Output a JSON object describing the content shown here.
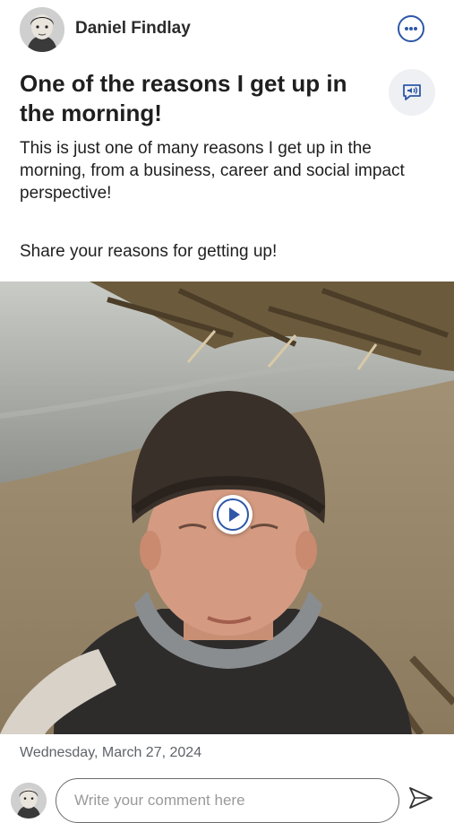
{
  "post": {
    "author": "Daniel Findlay",
    "title": "One of the reasons I get up in the morning!",
    "body": "This is just one of many reasons I get up in the morning, from a business, career and social impact perspective!",
    "body_2": "Share your reasons for getting up!",
    "date": "Wednesday, March 27, 2024"
  },
  "comment": {
    "placeholder": "Write your comment here"
  },
  "icons": {
    "more": "more-options-icon",
    "listen": "text-to-speech-icon",
    "play": "play-icon",
    "send": "send-icon"
  },
  "colors": {
    "accent": "#2f57a8",
    "text": "#1f1f1f",
    "muted": "#5f6368"
  }
}
